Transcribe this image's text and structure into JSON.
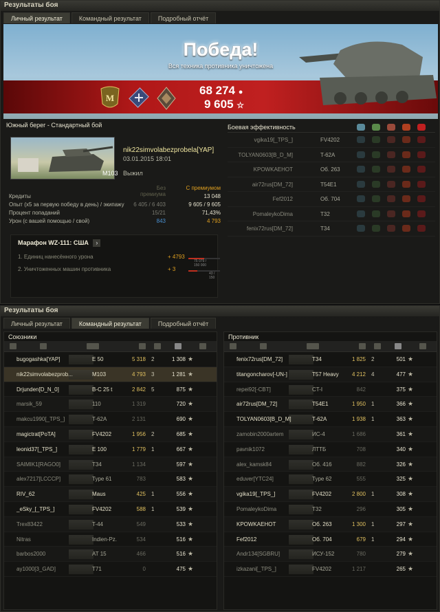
{
  "win1": {
    "title": "Результаты боя",
    "tabs": [
      "Личный результат",
      "Командный результат",
      "Подробный отчёт"
    ]
  },
  "banner": {
    "title": "Победа!",
    "subtitle": "Вся техника противника уничтожена",
    "credits": "68 274",
    "credits_icon": "coin-icon",
    "xp": "9 605",
    "xp_icon": "☆"
  },
  "battle": {
    "map": "Южный берег - Стандартный бой",
    "player": "nik22simvolabezprobela[YAP]",
    "date": "03.01.2015 18:01",
    "tank": "M103",
    "status": "Выжил"
  },
  "stats": {
    "col_a": "Без премиума",
    "col_b": "С премиумом",
    "rows": [
      {
        "label": "Кредиты",
        "a": "",
        "b": "13 048"
      },
      {
        "label": "Опыт (x5 за первую победу в день) / экипажу",
        "a": "6 405 / 6 403",
        "b": "9 605 / 9 605"
      },
      {
        "label": "Процент попаданий",
        "a": "15/21",
        "b": "71,43%"
      },
      {
        "label": "Урон (с вашей помощью / свой)",
        "a": "843",
        "b": "4 793"
      }
    ]
  },
  "marathon": {
    "title": "Марафон WZ-111: США",
    "btn": "›",
    "rows": [
      {
        "label": "1. Единиц нанесённого урона",
        "value": "+ 4793",
        "progress": "75 079 / 150 000",
        "frac": 0.5
      },
      {
        "label": "2. Уничтоженных машин противника",
        "value": "+ 3",
        "progress": "43 / 150",
        "frac": 0.29
      }
    ]
  },
  "efficiency": {
    "title": "Боевая эффективность",
    "rows": [
      {
        "name": "vgika19[_TPS_]",
        "tank": "FV4202"
      },
      {
        "name": "TOLYAN0603[B_D_M]",
        "tank": "T-62A"
      },
      {
        "name": "KPOWKAEHOT",
        "tank": "Об. 263"
      },
      {
        "name": "air72rus[DM_72]",
        "tank": "T54E1"
      },
      {
        "name": "Fef2012",
        "tank": "Об. 704"
      },
      {
        "name": "PomaleykoDima",
        "tank": "T32"
      },
      {
        "name": "fenix72rus[DM_72]",
        "tank": "T34"
      }
    ]
  },
  "win2": {
    "title": "Результаты боя",
    "tabs": [
      "Личный результат",
      "Командный результат",
      "Подробный отчёт"
    ]
  },
  "allies": {
    "title": "Союзники",
    "rows": [
      {
        "name": "bugogashka[YAP]",
        "tank": "E 50",
        "dmg": "5 318",
        "kills": "2",
        "xp": "1 308"
      },
      {
        "name": "nik22simvolabezprob...",
        "tank": "M103",
        "dmg": "4 793",
        "kills": "3",
        "xp": "1 281"
      },
      {
        "name": "Drjunden[D_N_0]",
        "tank": "B-C 25 t",
        "dmg": "2 842",
        "kills": "5",
        "xp": "875"
      },
      {
        "name": "marsik_59",
        "tank": "110",
        "dmg": "1 319",
        "kills": "",
        "xp": "720"
      },
      {
        "name": "makcu1990[_TPS_]",
        "tank": "T-62A",
        "dmg": "2 131",
        "kills": "",
        "xp": "690"
      },
      {
        "name": "magictrat[PoTA]",
        "tank": "FV4202",
        "dmg": "1 956",
        "kills": "2",
        "xp": "685"
      },
      {
        "name": "leonid37[_TPS_]",
        "tank": "E 100",
        "dmg": "1 779",
        "kills": "1",
        "xp": "667"
      },
      {
        "name": "SAIMIK1[RAGO0]",
        "tank": "T34",
        "dmg": "1 134",
        "kills": "",
        "xp": "597"
      },
      {
        "name": "alex7217[LCCCP]",
        "tank": "Type 61",
        "dmg": "783",
        "kills": "",
        "xp": "583"
      },
      {
        "name": "RIV_62",
        "tank": "Maus",
        "dmg": "425",
        "kills": "1",
        "xp": "556"
      },
      {
        "name": "_eSky_[_TPS_]",
        "tank": "FV4202",
        "dmg": "588",
        "kills": "1",
        "xp": "539"
      },
      {
        "name": "Trex83422",
        "tank": "T-44",
        "dmg": "549",
        "kills": "",
        "xp": "533"
      },
      {
        "name": "Nitras",
        "tank": "Indien-Pz.",
        "dmg": "534",
        "kills": "",
        "xp": "516"
      },
      {
        "name": "barbos2000",
        "tank": "AT 15",
        "dmg": "466",
        "kills": "",
        "xp": "516"
      },
      {
        "name": "ay1000[3_GAD]",
        "tank": "T71",
        "dmg": "0",
        "kills": "",
        "xp": "475"
      }
    ]
  },
  "enemies": {
    "title": "Противник",
    "rows": [
      {
        "name": "fenix72rus[DM_72]",
        "tank": "T34",
        "dmg": "1 825",
        "kills": "2",
        "xp": "501"
      },
      {
        "name": "titangoncharov[-UN-]",
        "tank": "T57 Heavy",
        "dmg": "4 212",
        "kills": "4",
        "xp": "477"
      },
      {
        "name": "repei92[-CBT]",
        "tank": "CT-I",
        "dmg": "842",
        "kills": "",
        "xp": "375"
      },
      {
        "name": "air72rus[DM_72]",
        "tank": "T54E1",
        "dmg": "1 950",
        "kills": "1",
        "xp": "366"
      },
      {
        "name": "TOLYAN0603[B_D_M]",
        "tank": "T-62A",
        "dmg": "1 938",
        "kills": "1",
        "xp": "363"
      },
      {
        "name": "zamobin2000artem",
        "tank": "ИС-4",
        "dmg": "1 686",
        "kills": "",
        "xp": "361"
      },
      {
        "name": "pavnik1072",
        "tank": "ЛТТБ",
        "dmg": "708",
        "kills": "",
        "xp": "340"
      },
      {
        "name": "alex_kamsk84",
        "tank": "Об. 416",
        "dmg": "882",
        "kills": "",
        "xp": "326"
      },
      {
        "name": "eduver[YTC24]",
        "tank": "Type 62",
        "dmg": "555",
        "kills": "",
        "xp": "325"
      },
      {
        "name": "vgika19[_TPS_]",
        "tank": "FV4202",
        "dmg": "2 800",
        "kills": "1",
        "xp": "308"
      },
      {
        "name": "PomaleykoDima",
        "tank": "T32",
        "dmg": "296",
        "kills": "",
        "xp": "305"
      },
      {
        "name": "KPOWKAEHOT",
        "tank": "Об. 263",
        "dmg": "1 300",
        "kills": "1",
        "xp": "297"
      },
      {
        "name": "Fef2012",
        "tank": "Об. 704",
        "dmg": "679",
        "kills": "1",
        "xp": "294"
      },
      {
        "name": "Andr134[SGBRU]",
        "tank": "ИСУ-152",
        "dmg": "780",
        "kills": "",
        "xp": "279"
      },
      {
        "name": "izkazani[_TPS_]",
        "tank": "FV4202",
        "dmg": "1 217",
        "kills": "",
        "xp": "265"
      }
    ]
  }
}
